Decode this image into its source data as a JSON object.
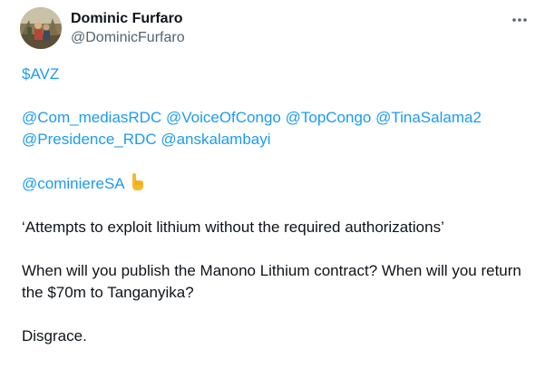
{
  "tweet": {
    "author": {
      "display_name": "Dominic Furfaro",
      "handle": "@DominicFurfaro",
      "avatar_icon": "profile-photo"
    },
    "more_icon": "more-horizontal-icon",
    "cashtag": "$AVZ",
    "mentions_line1": [
      "@Com_mediasRDC",
      "@VoiceOfCongo",
      "@TopCongo",
      "@TinaSalama2"
    ],
    "mentions_line2": [
      "@Presidence_RDC",
      "@anskalambayi"
    ],
    "mention_cominiere": "@cominiereSA",
    "emoji": "backhand-index-pointing-down-icon",
    "quote": "‘Attempts to exploit lithium without the required authorizations’",
    "question": "When will you publish the Manono Lithium contract? When will you return the $70m to Tanganyika?",
    "closing": "Disgrace."
  },
  "colors": {
    "link": "#1d9bf0",
    "text": "#0f1419",
    "secondary": "#536471",
    "emoji": "#f8b928"
  }
}
